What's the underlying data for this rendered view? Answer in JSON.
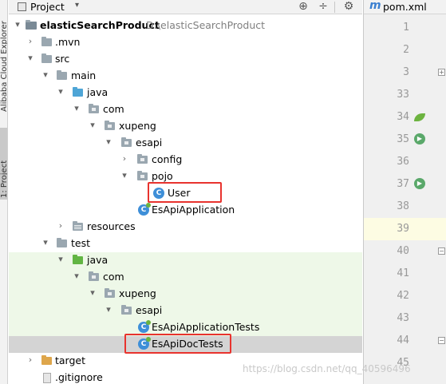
{
  "sidebar_strip": {
    "top_label": "Alibaba Cloud Explorer",
    "project_label": "1: Project"
  },
  "header": {
    "title": "Project",
    "caret": "▾",
    "buttons": {
      "locate": "⊕",
      "collapse": "÷",
      "settings": "⚙",
      "hide": "−"
    }
  },
  "tree": {
    "root_name": "elasticSearchProduct",
    "root_path": "D:\\elasticSearchProduct",
    "mvn": ".mvn",
    "src": "src",
    "main": "main",
    "java_main": "java",
    "com_main": "com",
    "xupeng_main": "xupeng",
    "esapi_main": "esapi",
    "config": "config",
    "pojo": "pojo",
    "user": "User",
    "app": "EsApiApplication",
    "resources": "resources",
    "test": "test",
    "java_test": "java",
    "com_test": "com",
    "xupeng_test": "xupeng",
    "esapi_test": "esapi",
    "app_tests": "EsApiApplicationTests",
    "doc_tests": "EsApiDocTests",
    "target": "target",
    "gitignore": ".gitignore"
  },
  "editor": {
    "tab_icon": "m",
    "tab_name": "pom.xml",
    "line_numbers": [
      "1",
      "2",
      "3",
      "33",
      "34",
      "35",
      "36",
      "37",
      "38",
      "39",
      "40",
      "41",
      "42",
      "43",
      "44",
      "45"
    ],
    "current_line": "39"
  },
  "watermark": "https://blog.csdn.net/qq_40596496"
}
